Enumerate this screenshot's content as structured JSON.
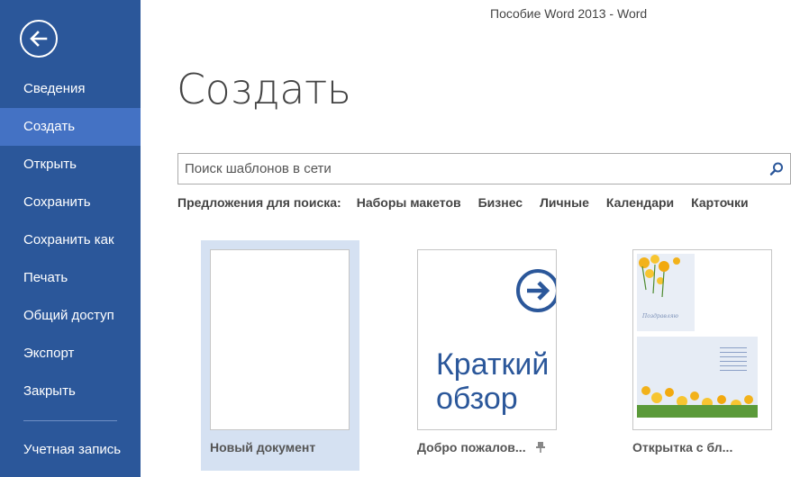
{
  "window": {
    "title": "Пособие Word 2013 - Word"
  },
  "sidebar": {
    "back_icon": "back-arrow-circle-icon",
    "items": [
      {
        "label": "Сведения",
        "active": false
      },
      {
        "label": "Создать",
        "active": true
      },
      {
        "label": "Открыть",
        "active": false
      },
      {
        "label": "Сохранить",
        "active": false
      },
      {
        "label": "Сохранить как",
        "active": false
      },
      {
        "label": "Печать",
        "active": false
      },
      {
        "label": "Общий доступ",
        "active": false
      },
      {
        "label": "Экспорт",
        "active": false
      },
      {
        "label": "Закрыть",
        "active": false
      }
    ],
    "account": "Учетная запись"
  },
  "main": {
    "title": "Создать",
    "search": {
      "placeholder": "Поиск шаблонов в сети",
      "value": "",
      "icon": "search-icon"
    },
    "suggestions": {
      "label": "Предложения для поиска:",
      "links": [
        "Наборы макетов",
        "Бизнес",
        "Личные",
        "Календари",
        "Карточки"
      ]
    },
    "templates": [
      {
        "name": "Новый документ",
        "selected": true
      },
      {
        "name": "Добро пожалов...",
        "thumb_text": [
          "Краткий",
          "обзор"
        ],
        "pinnable": true
      },
      {
        "name": "Открытка с бл...",
        "thumb_script": "Поздравляю"
      }
    ]
  },
  "colors": {
    "sidebar": "#2b579a",
    "sidebar_active": "#4472c4",
    "selected_tile": "#d5e1f2",
    "accent": "#2b579a"
  }
}
